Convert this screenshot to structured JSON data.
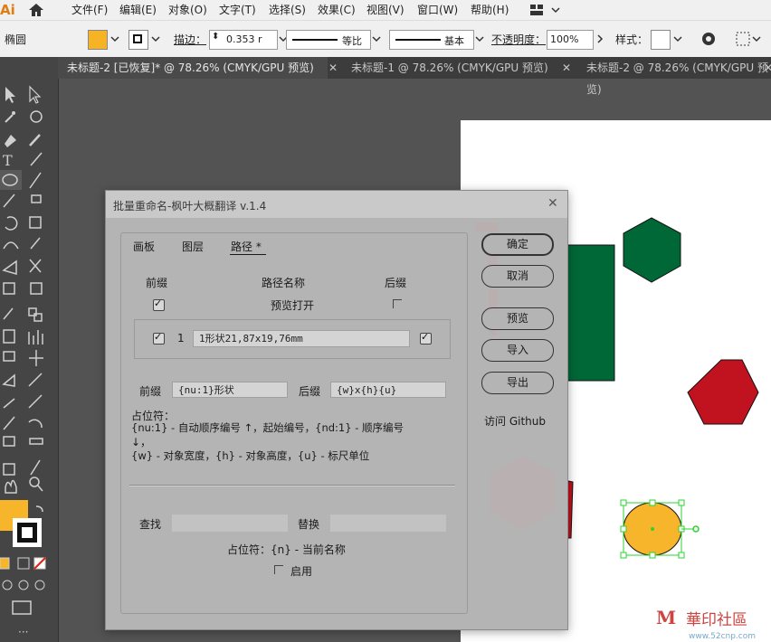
{
  "app": {
    "logo": "Ai"
  },
  "menu": [
    "文件(F)",
    "编辑(E)",
    "对象(O)",
    "文字(T)",
    "选择(S)",
    "效果(C)",
    "视图(V)",
    "窗口(W)",
    "帮助(H)"
  ],
  "control_bar": {
    "shape_name": "椭圆",
    "stroke_label": "描边：",
    "stroke_value": "0.353 r",
    "profile_label": "等比",
    "brush_label": "基本",
    "opacity_label": "不透明度：",
    "opacity_value": "100%",
    "style_label": "样式：",
    "fill_color": "#f5b325"
  },
  "tabs": [
    {
      "label": "未标题-2 [已恢复]* @ 78.26% (CMYK/GPU 预览)",
      "close": "✕"
    },
    {
      "label": "未标题-1 @ 78.26% (CMYK/GPU 预览)",
      "close": "✕"
    },
    {
      "label": "未标题-2 @ 78.26% (CMYK/GPU 预览)",
      "close": "✕"
    }
  ],
  "dialog": {
    "title": "批量重命名-枫叶大概翻译 v.1.4",
    "close": "✕",
    "tabs": [
      "画板",
      "图层",
      "路径 *"
    ],
    "col_prefix": "前缀",
    "col_name": "路径名称",
    "col_suffix": "后缀",
    "preview_open": "预览打开",
    "row_index": "1",
    "row_value": "1形状21,87x19,76mm",
    "prefix_label": "前缀",
    "prefix_value": "{nu:1}形状",
    "suffix_label": "后缀",
    "suffix_value": "{w}x{h}{u}",
    "ph_title": "占位符：",
    "ph_line1": "{nu:1} - 自动顺序编号  ↑，起始编号，{nd:1} - 顺序编号",
    "ph_line2": "↓，",
    "ph_line3": "{w} - 对象宽度，{h} - 对象高度，{u} - 标尺单位",
    "find_label": "查找",
    "replace_label": "替换",
    "ph_name": "占位符：{n} - 当前名称",
    "enable_label": "启用",
    "btn_ok": "确定",
    "btn_cancel": "取消",
    "btn_preview": "预览",
    "btn_import": "导入",
    "btn_export": "导出",
    "github": "访问 Github"
  },
  "colors": {
    "green": "#006837",
    "red": "#c1121f",
    "orange": "#f7b52b",
    "selection": "#29d42e"
  },
  "watermark": {
    "name": "華印社區",
    "url": "www.52cnp.com"
  }
}
